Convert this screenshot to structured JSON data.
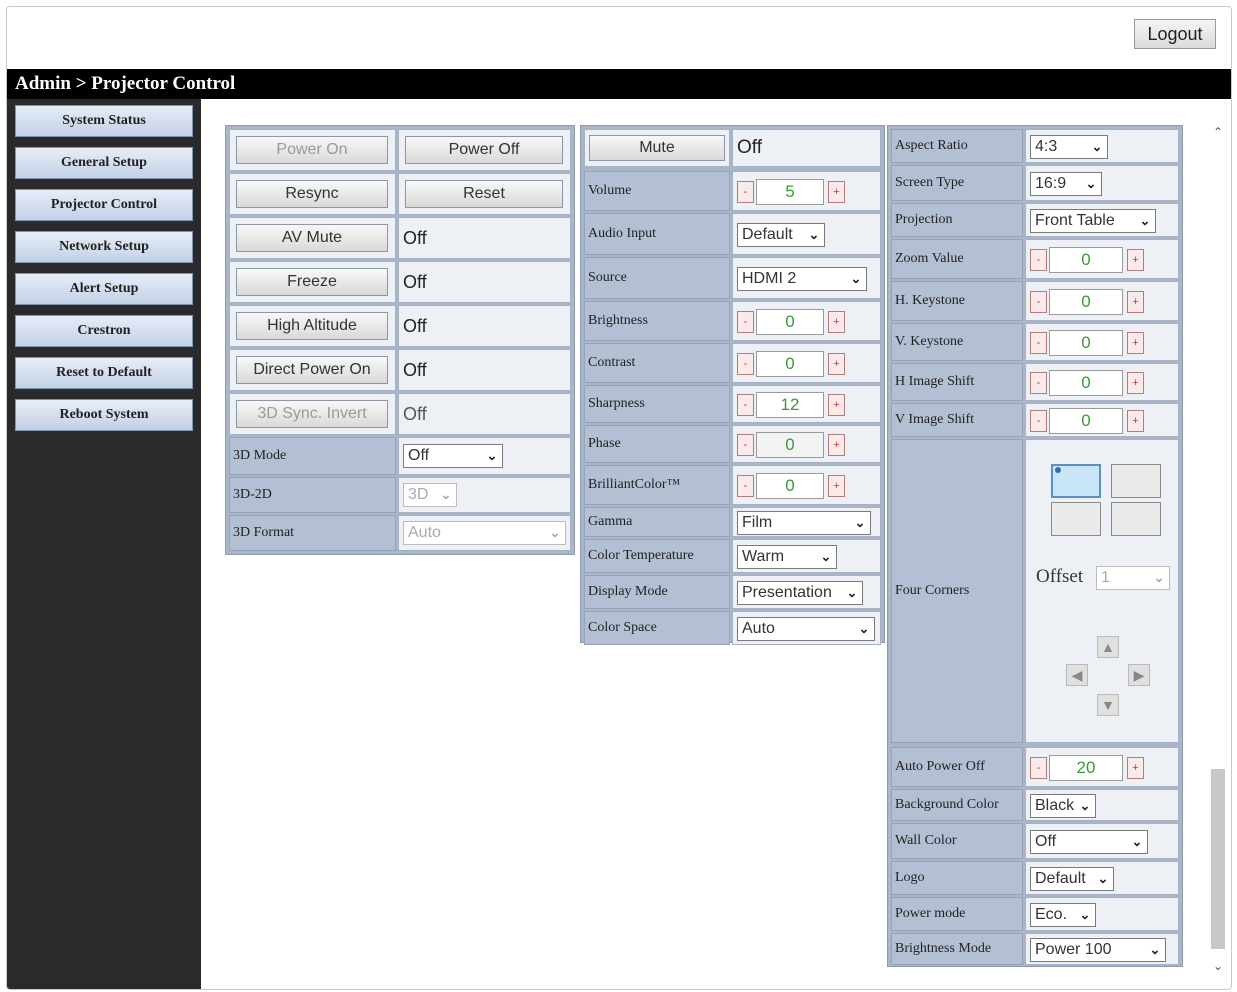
{
  "header": {
    "logout_label": "Logout",
    "breadcrumb": "Admin > Projector Control"
  },
  "sidebar": {
    "items": [
      "System Status",
      "General Setup",
      "Projector Control",
      "Network Setup",
      "Alert Setup",
      "Crestron",
      "Reset to Default",
      "Reboot System"
    ]
  },
  "power_panel": {
    "power_on": "Power On",
    "power_off": "Power Off",
    "resync": "Resync",
    "reset": "Reset",
    "av_mute": {
      "label": "AV Mute",
      "value": "Off"
    },
    "freeze": {
      "label": "Freeze",
      "value": "Off"
    },
    "high_altitude": {
      "label": "High Altitude",
      "value": "Off"
    },
    "direct_power_on": {
      "label": "Direct Power On",
      "value": "Off"
    },
    "sync_3d_invert": {
      "label": "3D Sync. Invert",
      "value": "Off"
    },
    "mode_3d": {
      "label": "3D Mode",
      "value": "Off"
    },
    "to2d_3d": {
      "label": "3D-2D",
      "value": "3D"
    },
    "format_3d": {
      "label": "3D Format",
      "value": "Auto"
    }
  },
  "image_panel": {
    "mute": {
      "label": "Mute",
      "value": "Off"
    },
    "volume": {
      "label": "Volume",
      "value": "5"
    },
    "audio_input": {
      "label": "Audio Input",
      "value": "Default"
    },
    "source": {
      "label": "Source",
      "value": "HDMI 2"
    },
    "brightness": {
      "label": "Brightness",
      "value": "0"
    },
    "contrast": {
      "label": "Contrast",
      "value": "0"
    },
    "sharpness": {
      "label": "Sharpness",
      "value": "12"
    },
    "phase": {
      "label": "Phase",
      "value": "0"
    },
    "brilliant_color": {
      "label": "BrilliantColor™",
      "value": "0"
    },
    "gamma": {
      "label": "Gamma",
      "value": "Film"
    },
    "color_temperature": {
      "label": "Color Temperature",
      "value": "Warm"
    },
    "display_mode": {
      "label": "Display Mode",
      "value": "Presentation"
    },
    "color_space": {
      "label": "Color Space",
      "value": "Auto"
    }
  },
  "display_panel": {
    "aspect_ratio": {
      "label": "Aspect Ratio",
      "value": "4:3"
    },
    "screen_type": {
      "label": "Screen Type",
      "value": "16:9"
    },
    "projection": {
      "label": "Projection",
      "value": "Front Table"
    },
    "zoom_value": {
      "label": "Zoom Value",
      "value": "0"
    },
    "h_keystone": {
      "label": "H. Keystone",
      "value": "0"
    },
    "v_keystone": {
      "label": "V. Keystone",
      "value": "0"
    },
    "h_image_shift": {
      "label": "H Image Shift",
      "value": "0"
    },
    "v_image_shift": {
      "label": "V Image Shift",
      "value": "0"
    },
    "four_corners": {
      "label": "Four Corners",
      "offset_label": "Offset",
      "offset_value": "1"
    },
    "auto_power_off": {
      "label": "Auto Power Off",
      "value": "20"
    },
    "background_color": {
      "label": "Background Color",
      "value": "Black"
    },
    "wall_color": {
      "label": "Wall Color",
      "value": "Off"
    },
    "logo": {
      "label": "Logo",
      "value": "Default"
    },
    "power_mode": {
      "label": "Power mode",
      "value": "Eco."
    },
    "brightness_mode": {
      "label": "Brightness Mode",
      "value": "Power 100"
    }
  },
  "icons": {
    "minus": "minus-icon",
    "plus": "plus-icon",
    "chevron": "chevron-down-icon",
    "arrows": [
      "arrow-up-icon",
      "arrow-left-icon",
      "arrow-right-icon",
      "arrow-down-icon"
    ]
  },
  "colors": {
    "title_bar": "#000000",
    "sidebar": "#2a2a2a",
    "label_cell": "#b3bfd2",
    "stepper_value": "#3a9a3a"
  }
}
